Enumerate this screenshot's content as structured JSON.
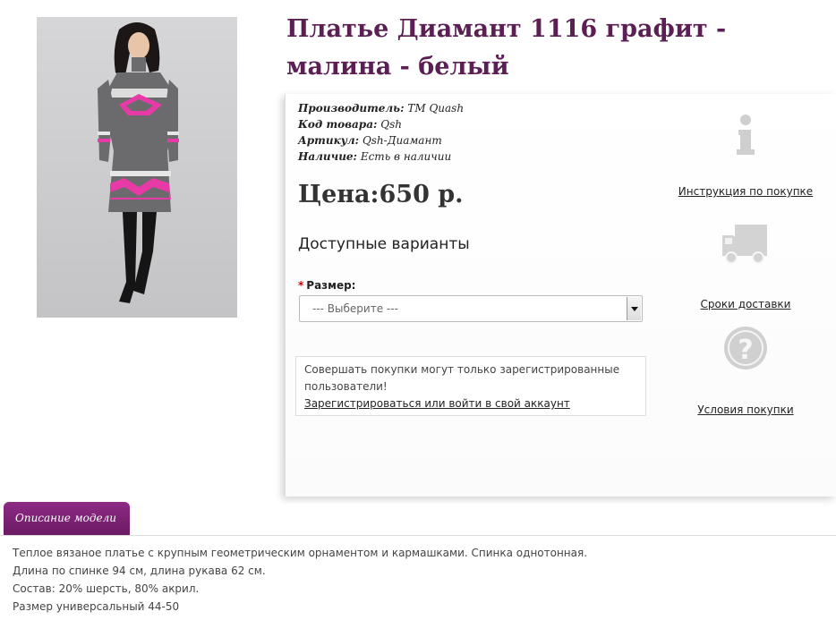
{
  "product": {
    "title": "Платье Диамант 1116 графит - малина - белый",
    "image_alt": "Платье Диамант 1116"
  },
  "meta": {
    "manufacturer_label": "Производитель:",
    "manufacturer_value": "ТМ Quash",
    "code_label": "Код товара:",
    "code_value": "Qsh",
    "article_label": "Артикул:",
    "article_value": "Qsh-Диамант",
    "stock_label": "Наличие:",
    "stock_value": "Есть в наличии"
  },
  "price": {
    "text": "Цена:650 р."
  },
  "variants": {
    "title": "Доступные варианты",
    "size_required_mark": "*",
    "size_label": "Размер:",
    "size_selected": "--- Выберите ---"
  },
  "notice": {
    "text": "Совершать покупки могут только зарегистрированные пользователи!",
    "link": "Зарегистрироваться или войти в свой аккаунт"
  },
  "side": {
    "instruction_link": "Инструкция по покупке",
    "delivery_link": "Сроки доставки",
    "terms_link": "Условия покупки"
  },
  "tabs": {
    "description_label": "Описание модели"
  },
  "description": {
    "lines": [
      "Теплое вязаное платье с крупным геометрическим орнаментом и кармашками. Спинка однотонная.",
      "Длина по спинке 94 см, длина рукава 62 см.",
      "Состав: 20% шерсть, 80% акрил.",
      "Размер универсальный 44-50"
    ]
  },
  "colors": {
    "title": "#5b1f54",
    "tab": "#7a2272",
    "dress_gray": "#6b6a6c",
    "dress_pink": "#e83aa7"
  }
}
